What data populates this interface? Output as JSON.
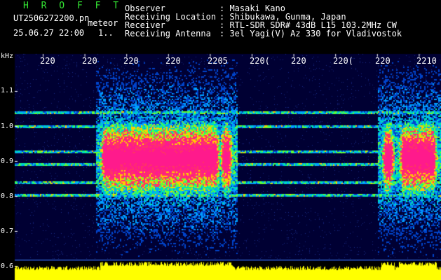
{
  "header": {
    "app_name": "H R O F F T",
    "file_name": "UT2506272200.pn",
    "type_label": "meteor",
    "datetime": "25.06.27 22:00",
    "page_marker": "1..",
    "fields": [
      {
        "label": "Observer",
        "value": ": Masaki Kano"
      },
      {
        "label": "Receiving Location",
        "value": ": Shibukawa, Gunma, Japan"
      },
      {
        "label": "Receiver",
        "value": ": RTL-SDR SDR# 43dB L15 103.2MHz CW"
      },
      {
        "label": "Receiving Antenna",
        "value": ": 3el Yagi(V) Az 330 for Vladivostok"
      }
    ]
  },
  "spectrogram": {
    "unit_label": "kHz",
    "y_ticks": [
      "1.1",
      "1.0",
      "0.9",
      "0.8",
      "0.7",
      "0.6"
    ],
    "x_ticks": [
      "220",
      "220",
      "220",
      "220",
      "2205",
      "220(",
      "220",
      "220(",
      "220",
      "2210"
    ],
    "colors": {
      "background": "#000033",
      "saturated": "#ff1a8c",
      "signal_bar": "#ffff00",
      "baseline": "#4488ff"
    },
    "bursts": [
      {
        "from": 0.2,
        "to": 0.48,
        "label": "long-burst-1"
      },
      {
        "from": 0.48,
        "to": 0.51,
        "label": "short-burst-2"
      },
      {
        "from": 0.86,
        "to": 0.89,
        "label": "short-burst-3"
      },
      {
        "from": 0.9,
        "to": 0.99,
        "label": "long-burst-4"
      }
    ]
  }
}
